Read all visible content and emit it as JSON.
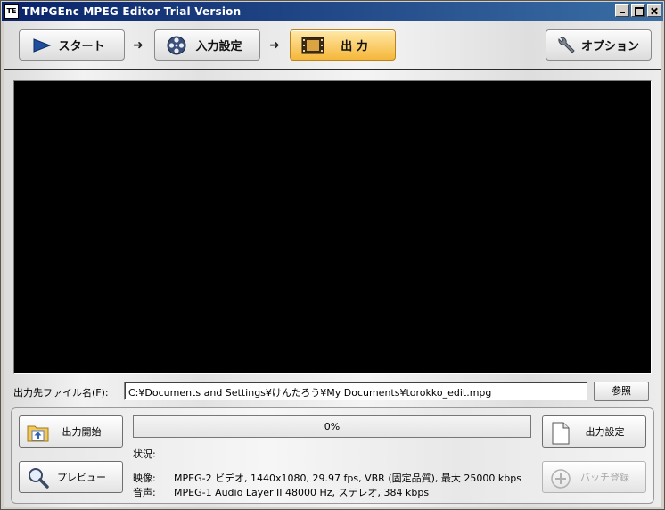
{
  "window": {
    "title": "TMPGEnc MPEG Editor Trial Version",
    "app_icon_text": "TE"
  },
  "toolbar": {
    "steps": [
      {
        "label": "スタート",
        "icon": "play-triangle-icon"
      },
      {
        "label": "入力設定",
        "icon": "film-reel-icon"
      },
      {
        "label": "出 力",
        "icon": "film-strip-icon",
        "active": true
      }
    ],
    "arrow": "➜",
    "options_label": "オプション",
    "options_icon": "wrench-icon"
  },
  "output": {
    "label": "出力先ファイル名(F):",
    "path": "C:¥Documents and Settings¥けんたろう¥My Documents¥torokko_edit.mpg",
    "browse_label": "参照"
  },
  "panel": {
    "start_output_label": "出力開始",
    "preview_label": "プレビュー",
    "output_settings_label": "出力設定",
    "batch_register_label": "バッチ登録",
    "progress_text": "0%",
    "progress_value": 0,
    "status_label": "状況:",
    "video_key": "映像:",
    "video_value": "MPEG-2 ビデオ, 1440x1080, 29.97 fps, VBR (固定品質), 最大 25000 kbps",
    "audio_key": "音声:",
    "audio_value": "MPEG-1 Audio Layer II 48000 Hz, ステレオ, 384 kbps"
  },
  "colors": {
    "active_step": "#f5b73a",
    "title_bar": "#0a246a",
    "video_bg": "#000000",
    "play_icon": "#1f4f9c"
  }
}
